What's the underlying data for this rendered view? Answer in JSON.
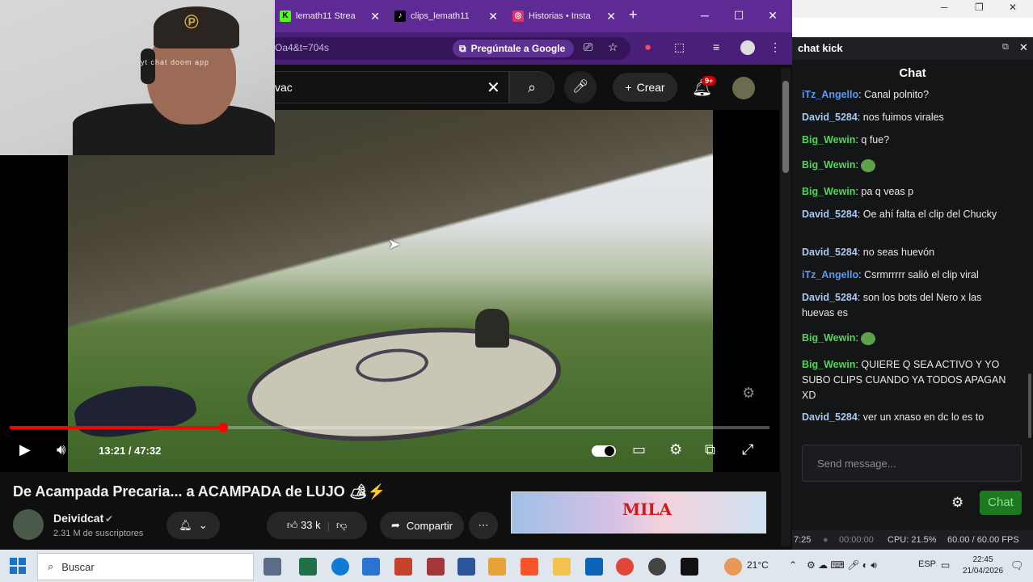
{
  "browser": {
    "tabs": [
      {
        "label": "lemath11 Strea",
        "icon": "kick-icon",
        "color": "#53fc18"
      },
      {
        "label": "clips_lemath11",
        "icon": "tiktok-icon",
        "color": "#000000"
      },
      {
        "label": "Historias • Insta",
        "icon": "instagram-icon",
        "color": "#e1306c"
      }
    ],
    "url": "Oa4&t=704s",
    "google_pill": "Pregúntale a Google"
  },
  "youtube": {
    "search_value": "vac",
    "create_label": "Crear",
    "notif_count": "9+",
    "player": {
      "time": "13:21 / 47:32",
      "progress": 0.281
    },
    "video_title": "De Acampada Precaria... a ACAMPADA de LUJO 🏕⚡",
    "channel": {
      "name": "Deividcat",
      "subscribers": "2.31 M de suscriptores"
    },
    "likes": "33 k",
    "share_label": "Compartir",
    "ad_brand": "MILA"
  },
  "webcam": {
    "overlay_text": "yt chat doom app"
  },
  "chat": {
    "window_title": "chat kick",
    "heading": "Chat",
    "messages": [
      {
        "user": "iTz_Angello",
        "text": "Canal polnito?",
        "color": "#5a9bef"
      },
      {
        "user": "David_5284",
        "text": "nos fuimos virales",
        "color": "#a8c8f0"
      },
      {
        "user": "Big_Wewin",
        "text": "q fue?",
        "color": "#53d45a"
      },
      {
        "user": "Big_Wewin",
        "text": "",
        "color": "#53d45a",
        "emote": true
      },
      {
        "user": "Big_Wewin",
        "text": "pa q veas p",
        "color": "#53d45a"
      },
      {
        "user": "David_5284",
        "text": "Oe ahí falta el clip del Chucky",
        "color": "#a8c8f0"
      },
      {
        "user": "David_5284",
        "text": "no seas huevón",
        "color": "#a8c8f0"
      },
      {
        "user": "iTz_Angello",
        "text": "Csrmrrrrr salió el clip viral",
        "color": "#5a9bef"
      },
      {
        "user": "David_5284",
        "text": "son los bots del Nero x las huevas es",
        "color": "#a8c8f0"
      },
      {
        "user": "Big_Wewin",
        "text": "",
        "color": "#53d45a",
        "emote": true
      },
      {
        "user": "Big_Wewin",
        "text": "QUIERE Q SEA ACTIVO Y YO SUBO CLIPS CUANDO YA TODOS APAGAN XD",
        "color": "#53d45a"
      },
      {
        "user": "David_5284",
        "text": "ver un xnaso en dc lo es to",
        "color": "#a8c8f0"
      }
    ],
    "input_placeholder": "Send message...",
    "send_label": "Chat"
  },
  "obs": {
    "time_left": "7:25",
    "rec_time": "00:00:00",
    "cpu": "CPU: 21.5%",
    "fps": "60.00 / 60.00 FPS"
  },
  "taskbar": {
    "search_placeholder": "Buscar",
    "weather": "21°C",
    "lang": "ESP",
    "time": "22:45",
    "date": "21/04/2026"
  }
}
